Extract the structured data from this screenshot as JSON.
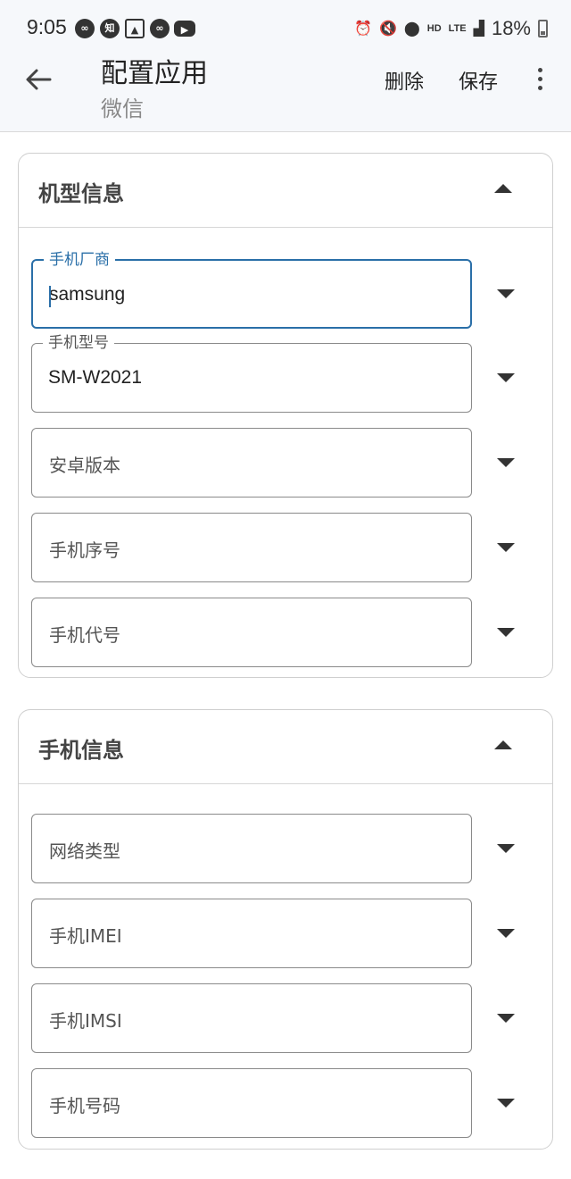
{
  "status_bar": {
    "time": "9:05",
    "left_icons": [
      "infinity-icon",
      "zhihu-icon",
      "image-icon",
      "infinity-icon",
      "youtube-icon"
    ],
    "zhihu_glyph": "知",
    "hd": "HD",
    "network": "LTE",
    "battery": "18%"
  },
  "appbar": {
    "title": "配置应用",
    "subtitle": "微信",
    "delete_label": "删除",
    "save_label": "保存"
  },
  "sections": [
    {
      "title": "机型信息",
      "fields": [
        {
          "label": "手机厂商",
          "value": "samsung",
          "focused": true
        },
        {
          "label": "手机型号",
          "value": "SM-W2021"
        },
        {
          "placeholder": "安卓版本"
        },
        {
          "placeholder": "手机序号"
        },
        {
          "placeholder": "手机代号"
        }
      ]
    },
    {
      "title": "手机信息",
      "fields": [
        {
          "placeholder": "网络类型"
        },
        {
          "placeholder": "手机IMEI"
        },
        {
          "placeholder": "手机IMSI"
        },
        {
          "placeholder": "手机号码"
        }
      ]
    }
  ],
  "colors": {
    "accent": "#2a6fa8",
    "appbar_bg": "#f6f8fb",
    "outline": "#8a8a8a"
  }
}
